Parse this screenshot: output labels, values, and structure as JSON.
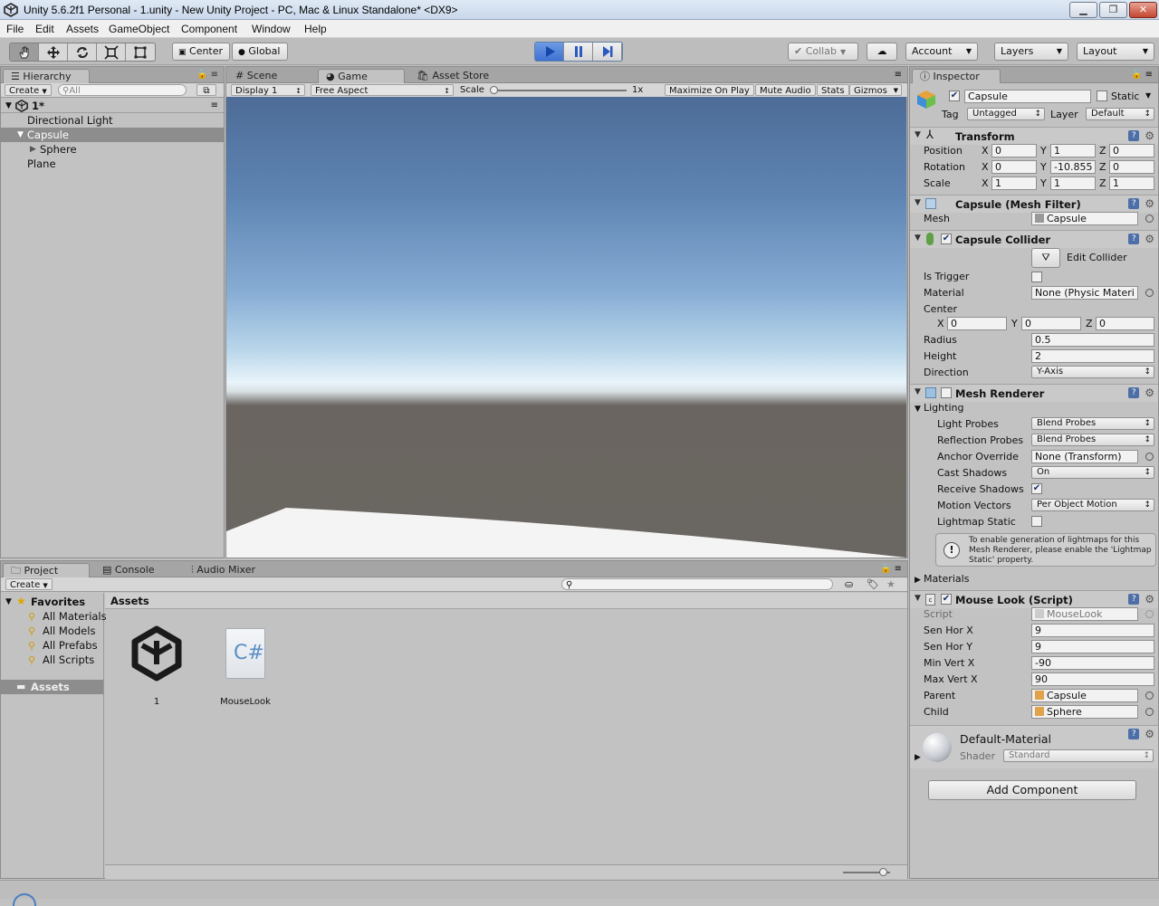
{
  "window": {
    "title": "Unity 5.6.2f1 Personal - 1.unity - New Unity Project - PC, Mac & Linux Standalone* <DX9>",
    "controls": {
      "minimize": "▁",
      "maximize": "❐",
      "close": "✕"
    }
  },
  "menu": [
    "File",
    "Edit",
    "Assets",
    "GameObject",
    "Component",
    "Window",
    "Help"
  ],
  "toolbar": {
    "center": "Center",
    "global": "Global",
    "collab": "Collab",
    "account": "Account",
    "layers": "Layers",
    "layout": "Layout"
  },
  "hierarchy": {
    "tab": "Hierarchy",
    "create": "Create",
    "search_placeholder": "All",
    "scene": "1*",
    "items": [
      "Directional Light",
      "Capsule",
      "Sphere",
      "Plane"
    ]
  },
  "game": {
    "tabs": [
      "Scene",
      "Game",
      "Asset Store"
    ],
    "display": "Display 1",
    "aspect": "Free Aspect",
    "scale_label": "Scale",
    "scale_value": "1x",
    "maximize_on_play": "Maximize On Play",
    "mute_audio": "Mute Audio",
    "stats": "Stats",
    "gizmos": "Gizmos"
  },
  "project": {
    "tabs": [
      "Project",
      "Console",
      "Audio Mixer"
    ],
    "create": "Create",
    "favorites_label": "Favorites",
    "favorites": [
      "All Materials",
      "All Models",
      "All Prefabs",
      "All Scripts"
    ],
    "assets_label": "Assets",
    "breadcrumb": "Assets",
    "items": [
      {
        "name": "1"
      },
      {
        "name": "MouseLook"
      }
    ]
  },
  "inspector": {
    "tab": "Inspector",
    "object": {
      "name": "Capsule",
      "static_label": "Static",
      "tag_label": "Tag",
      "tag": "Untagged",
      "layer_label": "Layer",
      "layer": "Default"
    },
    "transform": {
      "title": "Transform",
      "position_label": "Position",
      "rotation_label": "Rotation",
      "scale_label": "Scale",
      "position": [
        "0",
        "1",
        "0"
      ],
      "rotation": [
        "0",
        "-10.855",
        "0"
      ],
      "scale": [
        "1",
        "1",
        "1"
      ],
      "axes": [
        "X",
        "Y",
        "Z"
      ]
    },
    "mesh_filter": {
      "title": "Capsule (Mesh Filter)",
      "mesh_label": "Mesh",
      "mesh": "Capsule"
    },
    "collider": {
      "title": "Capsule Collider",
      "edit": "Edit Collider",
      "is_trigger": "Is Trigger",
      "material_label": "Material",
      "material": "None (Physic Materi",
      "center_label": "Center",
      "center": [
        "0",
        "0",
        "0"
      ],
      "radius_label": "Radius",
      "radius": "0.5",
      "height_label": "Height",
      "height": "2",
      "direction_label": "Direction",
      "direction": "Y-Axis"
    },
    "renderer": {
      "title": "Mesh Renderer",
      "lighting": "Lighting",
      "light_probes_label": "Light Probes",
      "light_probes": "Blend Probes",
      "reflection_label": "Reflection Probes",
      "reflection": "Blend Probes",
      "anchor_label": "Anchor Override",
      "anchor": "None (Transform)",
      "cast_label": "Cast Shadows",
      "cast": "On",
      "receive_label": "Receive Shadows",
      "motion_label": "Motion Vectors",
      "motion": "Per Object Motion",
      "lightmap_label": "Lightmap Static",
      "help": "To enable generation of lightmaps for this Mesh Renderer, please enable the 'Lightmap Static' property.",
      "materials": "Materials"
    },
    "script": {
      "title": "Mouse Look (Script)",
      "script_label": "Script",
      "script": "MouseLook",
      "sen_hor_x_label": "Sen Hor X",
      "sen_hor_x": "9",
      "sen_hor_y_label": "Sen Hor Y",
      "sen_hor_y": "9",
      "min_vert_x_label": "Min Vert X",
      "min_vert_x": "-90",
      "max_vert_x_label": "Max Vert X",
      "max_vert_x": "90",
      "parent_label": "Parent",
      "parent": "Capsule",
      "child_label": "Child",
      "child": "Sphere"
    },
    "material": {
      "name": "Default-Material",
      "shader_label": "Shader",
      "shader": "Standard"
    },
    "add_component": "Add Component"
  },
  "colors": {
    "play_active": "#3e72d2",
    "selection": "#8d8d8d",
    "title_gradient_top": "#dfe9f5"
  }
}
